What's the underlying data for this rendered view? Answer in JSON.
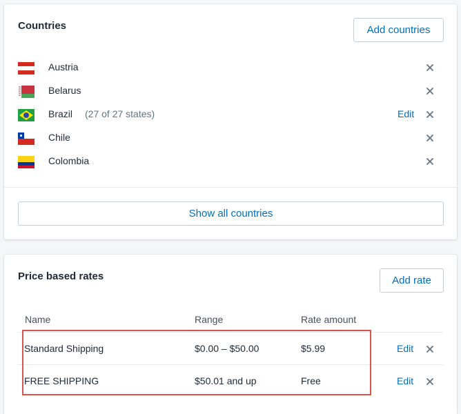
{
  "countries_card": {
    "title": "Countries",
    "add_button": "Add countries",
    "show_all_button": "Show all countries",
    "items": [
      {
        "name": "Austria",
        "detail": "",
        "edit": "",
        "flag": "austria-flag-icon"
      },
      {
        "name": "Belarus",
        "detail": "",
        "edit": "",
        "flag": "belarus-flag-icon"
      },
      {
        "name": "Brazil",
        "detail": "(27 of 27 states)",
        "edit": "Edit",
        "flag": "brazil-flag-icon"
      },
      {
        "name": "Chile",
        "detail": "",
        "edit": "",
        "flag": "chile-flag-icon"
      },
      {
        "name": "Colombia",
        "detail": "",
        "edit": "",
        "flag": "colombia-flag-icon"
      }
    ]
  },
  "rates_card": {
    "title": "Price based rates",
    "add_button": "Add rate",
    "columns": [
      "Name",
      "Range",
      "Rate amount"
    ],
    "rows": [
      {
        "name": "Standard Shipping",
        "range": "$0.00 – $50.00",
        "amount": "$5.99",
        "edit": "Edit"
      },
      {
        "name": "FREE SHIPPING",
        "range": "$50.01 and up",
        "amount": "Free",
        "edit": "Edit"
      }
    ]
  },
  "colors": {
    "link": "#006fbb",
    "text": "#212b36",
    "subdued": "#637381",
    "highlight": "#d9534f",
    "background": "#f4f6f8"
  }
}
